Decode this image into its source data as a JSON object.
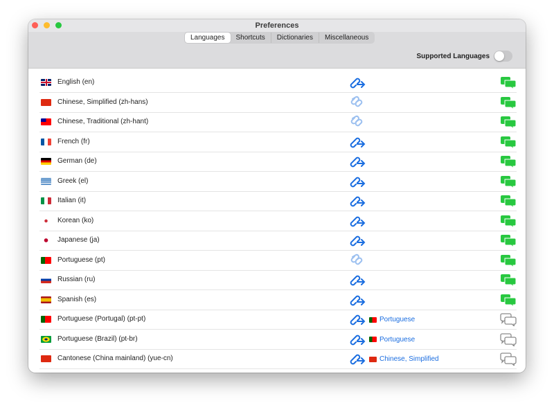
{
  "window": {
    "title": "Preferences"
  },
  "tabs": [
    {
      "label": "Languages",
      "selected": true
    },
    {
      "label": "Shortcuts"
    },
    {
      "label": "Dictionaries"
    },
    {
      "label": "Miscellaneous"
    }
  ],
  "supported_languages": {
    "label": "Supported Languages",
    "on": false
  },
  "colors": {
    "accent": "#1a6de0",
    "chat_enabled": "#28c840",
    "chat_disabled": "#8a8a8a"
  },
  "languages": [
    {
      "name": "English (en)",
      "flag": "gb",
      "link": "active",
      "chat": "enabled"
    },
    {
      "name": "Chinese, Simplified (zh-hans)",
      "flag": "cn",
      "link": "inactive",
      "chat": "enabled"
    },
    {
      "name": "Chinese, Traditional (zh-hant)",
      "flag": "tw",
      "link": "inactive",
      "chat": "enabled"
    },
    {
      "name": "French (fr)",
      "flag": "fr",
      "link": "active",
      "chat": "enabled"
    },
    {
      "name": "German (de)",
      "flag": "de",
      "link": "active",
      "chat": "enabled"
    },
    {
      "name": "Greek (el)",
      "flag": "gr",
      "link": "active",
      "chat": "enabled"
    },
    {
      "name": "Italian (it)",
      "flag": "it",
      "link": "active",
      "chat": "enabled"
    },
    {
      "name": "Korean (ko)",
      "flag": "kr",
      "link": "active",
      "chat": "enabled"
    },
    {
      "name": "Japanese (ja)",
      "flag": "jp",
      "link": "active",
      "chat": "enabled"
    },
    {
      "name": "Portuguese (pt)",
      "flag": "pt",
      "link": "inactive",
      "chat": "enabled"
    },
    {
      "name": "Russian (ru)",
      "flag": "ru",
      "link": "active",
      "chat": "enabled"
    },
    {
      "name": "Spanish (es)",
      "flag": "es",
      "link": "active",
      "chat": "enabled"
    },
    {
      "name": "Portuguese (Portugal) (pt-pt)",
      "flag": "pt",
      "link": "active",
      "fallback": {
        "label": "Portuguese",
        "flag": "pt"
      },
      "chat": "disabled"
    },
    {
      "name": "Portuguese (Brazil) (pt-br)",
      "flag": "br",
      "link": "active",
      "fallback": {
        "label": "Portuguese",
        "flag": "pt"
      },
      "chat": "disabled"
    },
    {
      "name": "Cantonese (China mainland) (yue-cn)",
      "flag": "cn",
      "link": "active",
      "fallback": {
        "label": "Chinese, Simplified",
        "flag": "cn"
      },
      "chat": "disabled"
    }
  ]
}
